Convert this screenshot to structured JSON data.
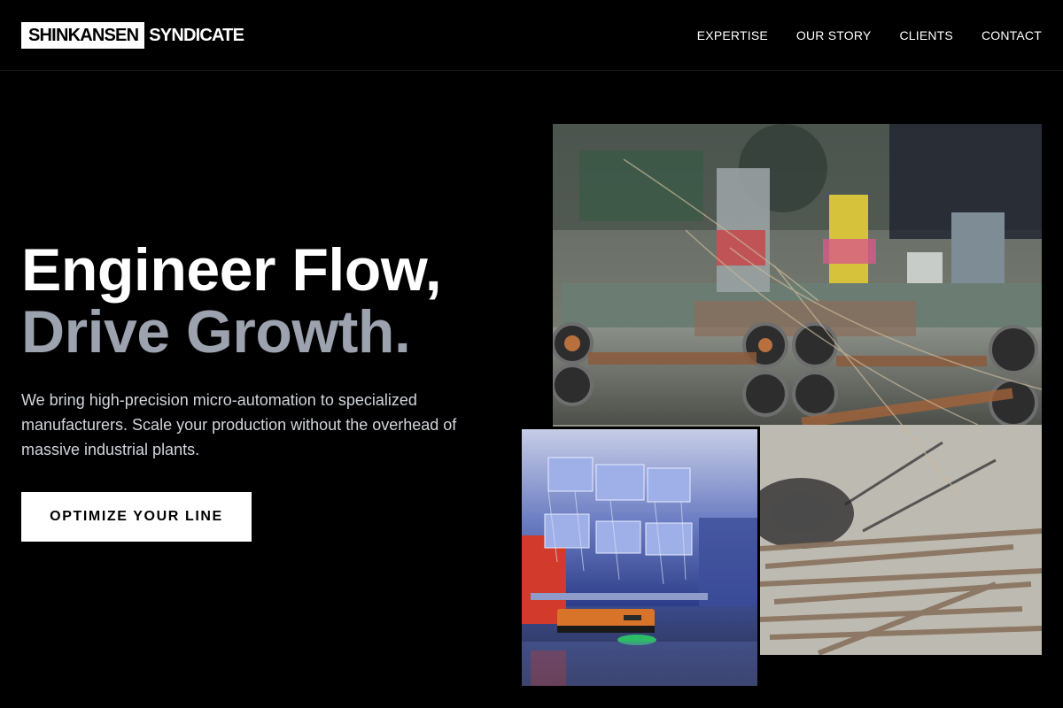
{
  "header": {
    "logo_box": "SHINKANSEN",
    "logo_text": "SYNDICATE",
    "nav": [
      {
        "label": "EXPERTISE"
      },
      {
        "label": "OUR STORY"
      },
      {
        "label": "CLIENTS"
      },
      {
        "label": "CONTACT"
      }
    ]
  },
  "hero": {
    "headline_line1": "Engineer Flow,",
    "headline_line2": "Drive Growth.",
    "subtext": "We bring high-precision micro-automation to specialized manufacturers. Scale your production without the overhead of massive industrial plants.",
    "cta_label": "OPTIMIZE YOUR LINE"
  },
  "colors": {
    "background": "#000000",
    "accent_gray": "#9ca3af",
    "cta_bg": "#ffffff"
  }
}
